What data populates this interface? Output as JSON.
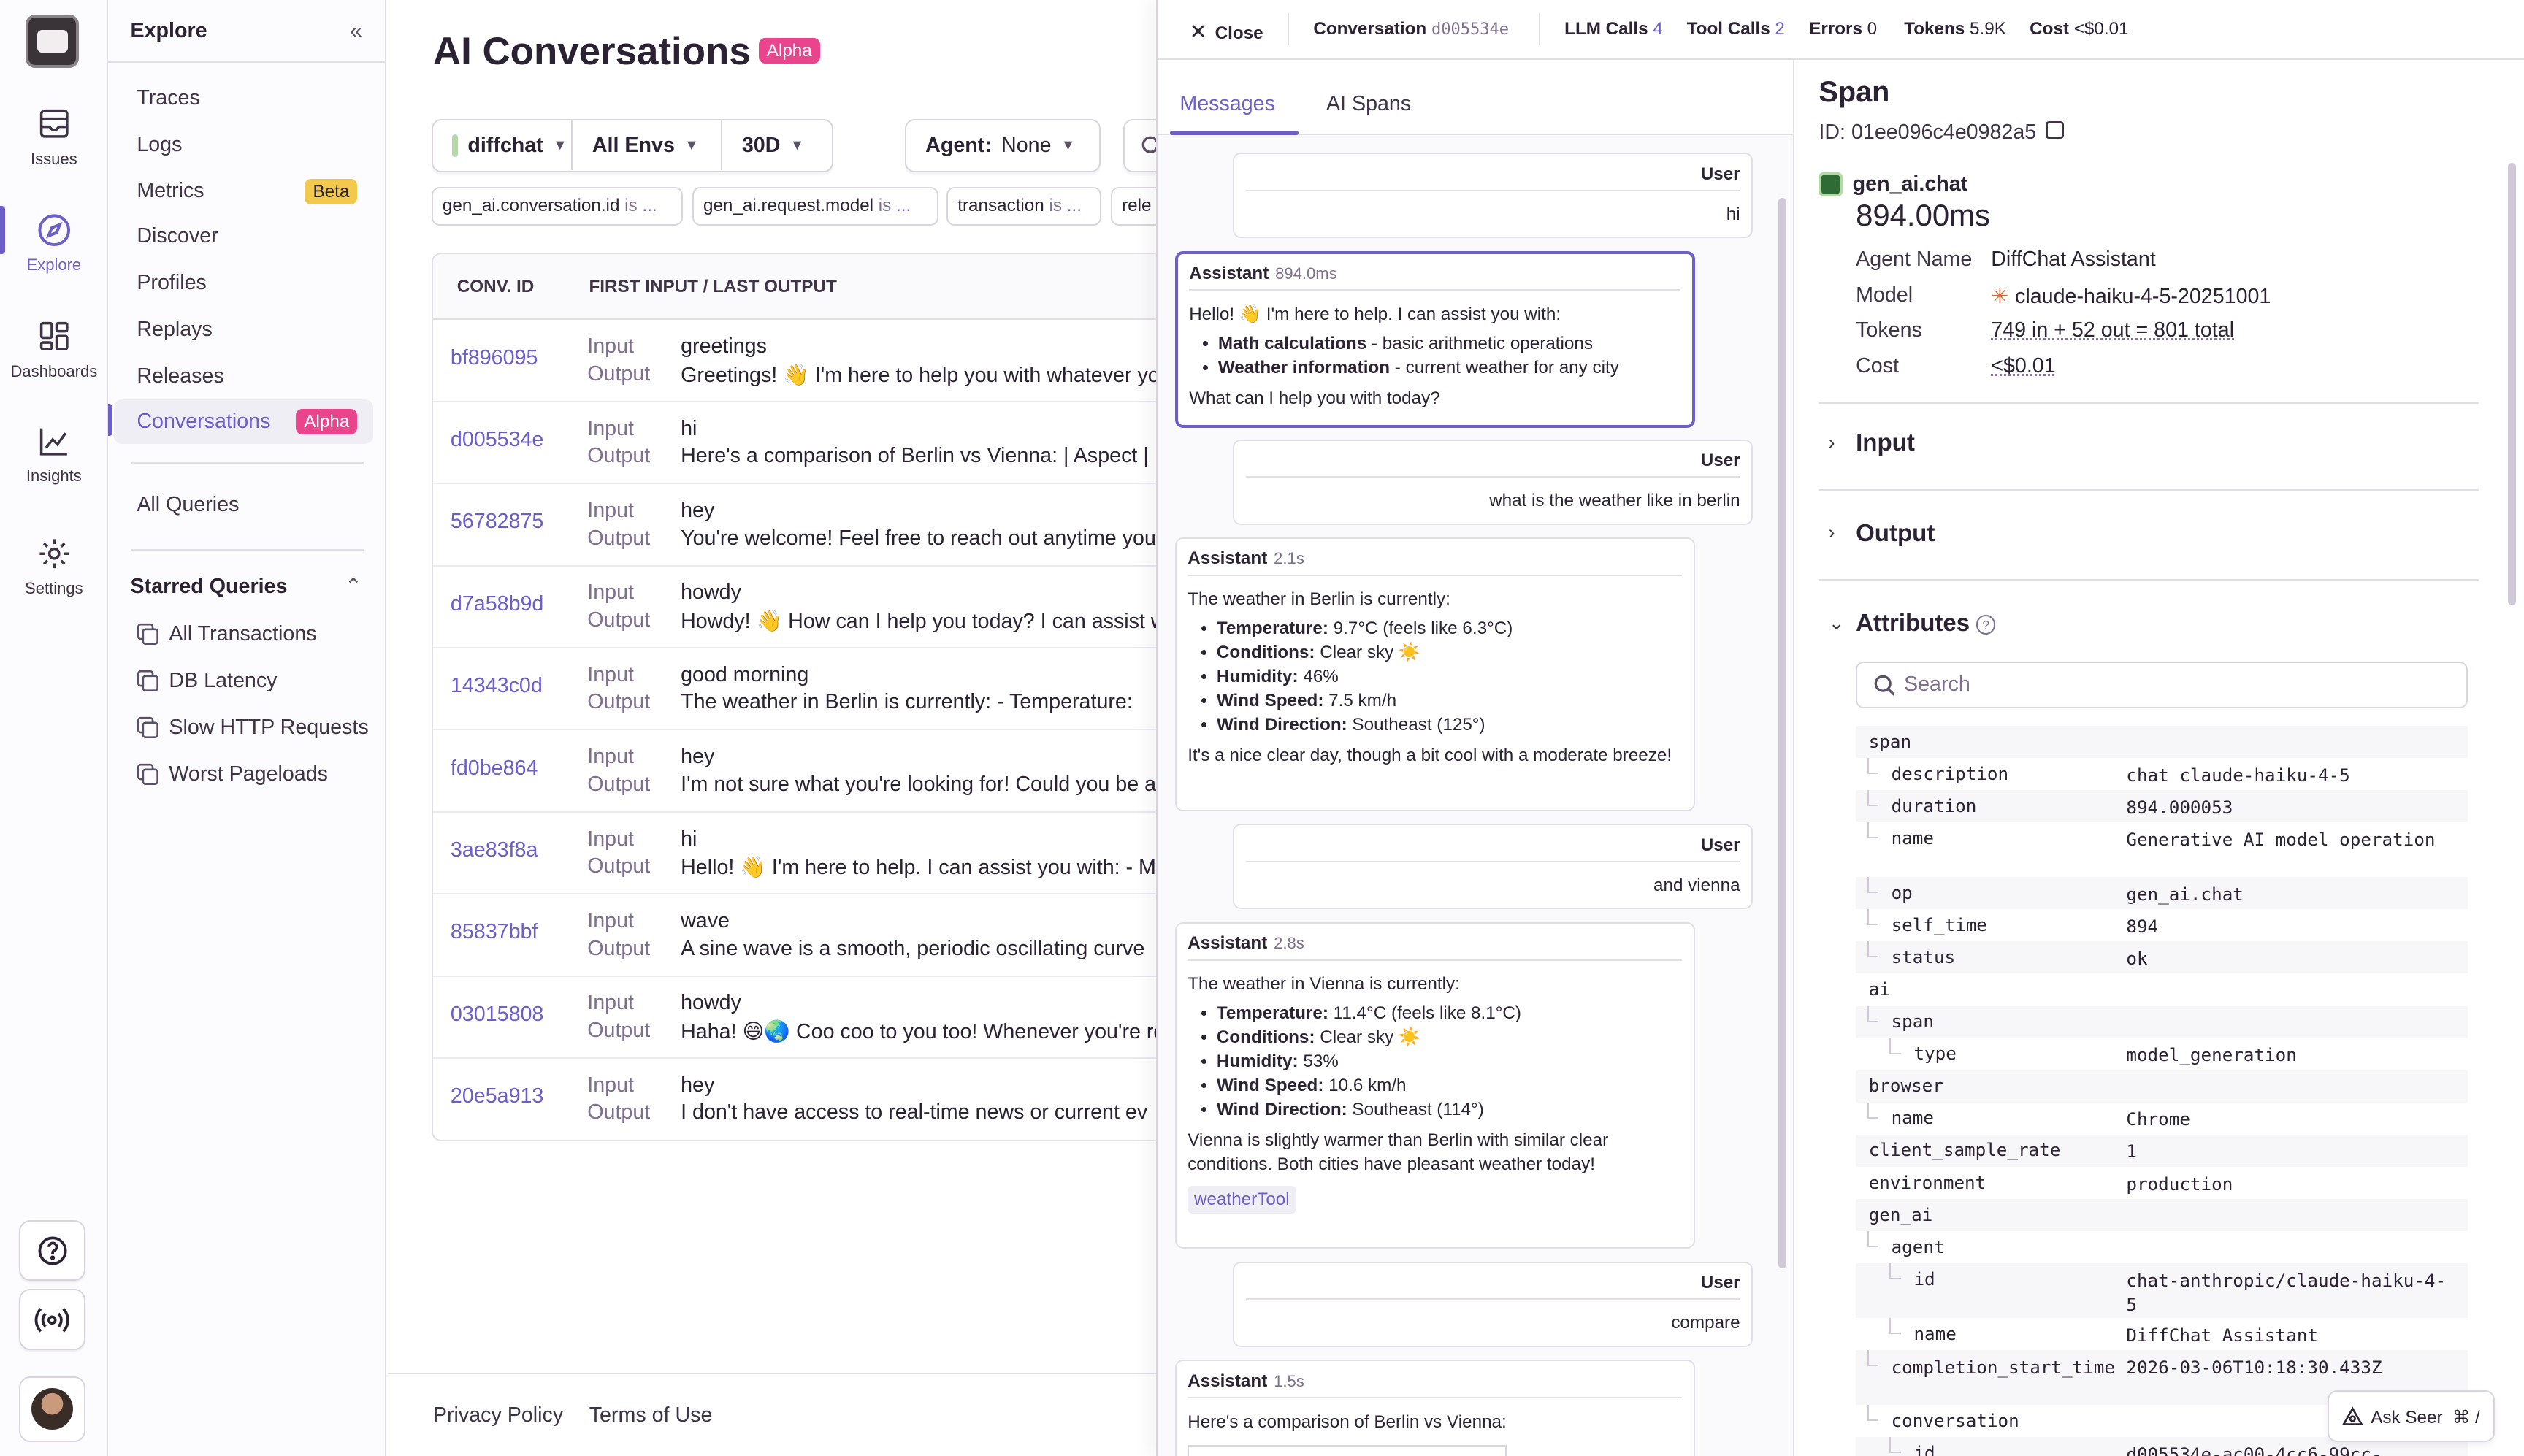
{
  "rail": {
    "items": [
      {
        "label": "Issues",
        "icon": "issues-icon"
      },
      {
        "label": "Explore",
        "icon": "compass-icon"
      },
      {
        "label": "Dashboards",
        "icon": "dashboards-icon"
      },
      {
        "label": "Insights",
        "icon": "insights-icon"
      },
      {
        "label": "Settings",
        "icon": "gear-icon"
      }
    ],
    "active": "Explore"
  },
  "nav": {
    "title": "Explore",
    "items": [
      "Traces",
      "Logs",
      "Metrics",
      "Discover",
      "Profiles",
      "Replays",
      "Releases",
      "Conversations"
    ],
    "metrics_badge": "Beta",
    "conversations_badge": "Alpha",
    "all_queries": "All Queries",
    "starred_title": "Starred Queries",
    "starred": [
      "All Transactions",
      "DB Latency",
      "Slow HTTP Requests",
      "Worst Pageloads"
    ]
  },
  "main": {
    "title": "AI Conversations",
    "title_badge": "Alpha",
    "project": "diffchat",
    "env": "All Envs",
    "range": "30D",
    "agent_label": "Agent:",
    "agent_value": "None",
    "pills": [
      {
        "key": "gen_ai.conversation.id",
        "op": "is",
        "val": "..."
      },
      {
        "key": "gen_ai.request.model",
        "op": "is",
        "val": "..."
      },
      {
        "key": "transaction",
        "op": "is",
        "val": "..."
      },
      {
        "key": "rele",
        "op": "",
        "val": ""
      }
    ],
    "columns": [
      "CONV. ID",
      "FIRST INPUT / LAST OUTPUT"
    ],
    "input_label": "Input",
    "output_label": "Output",
    "rows": [
      {
        "id": "bf896095",
        "input": "greetings",
        "output": "Greetings! 👋 I'm here to help you with whatever yo"
      },
      {
        "id": "d005534e",
        "input": "hi",
        "output": "Here's a comparison of Berlin vs Vienna: | Aspect |"
      },
      {
        "id": "56782875",
        "input": "hey",
        "output": "You're welcome! Feel free to reach out anytime you"
      },
      {
        "id": "d7a58b9d",
        "input": "howdy",
        "output": "Howdy! 👋 How can I help you today? I can assist w"
      },
      {
        "id": "14343c0d",
        "input": "good morning",
        "output": "The weather in Berlin is currently: - Temperature:"
      },
      {
        "id": "fd0be864",
        "input": "hey",
        "output": "I'm not sure what you're looking for! Could you be a"
      },
      {
        "id": "3ae83f8a",
        "input": "hi",
        "output": "Hello! 👋 I'm here to help. I can assist you with: - Ma"
      },
      {
        "id": "85837bbf",
        "input": "wave",
        "output": "A sine wave is a smooth, periodic oscillating curve"
      },
      {
        "id": "03015808",
        "input": "howdy",
        "output": "Haha! 😄🌏 Coo coo to you too! Whenever you're rea"
      },
      {
        "id": "20e5a913",
        "input": "hey",
        "output": "I don't have access to real-time news or current ev"
      }
    ],
    "footer": [
      "Privacy Policy",
      "Terms of Use"
    ]
  },
  "drawer": {
    "close": "Close",
    "conversation_label": "Conversation",
    "conversation_id": "d005534e",
    "llm_calls_label": "LLM Calls",
    "llm_calls": "4",
    "tool_calls_label": "Tool Calls",
    "tool_calls": "2",
    "errors_label": "Errors",
    "errors": "0",
    "tokens_label": "Tokens",
    "tokens": "5.9K",
    "cost_label": "Cost",
    "cost": "<$0.01",
    "tabs": [
      "Messages",
      "AI Spans"
    ],
    "messages": {
      "user_label": "User",
      "assistant_label": "Assistant",
      "m1_user": "hi",
      "m2_time": "894.0ms",
      "m2_intro": "Hello! 👋 I'm here to help. I can assist you with:",
      "m2_b1k": "Math calculations",
      "m2_b1v": " - basic arithmetic operations",
      "m2_b2k": "Weather information",
      "m2_b2v": " - current weather for any city",
      "m2_outro": "What can I help you with today?",
      "m3_user": "what is the weather like in berlin",
      "m4_time": "2.1s",
      "m4_intro": "The weather in Berlin is currently:",
      "m4_b1k": "Temperature:",
      "m4_b1v": " 9.7°C (feels like 6.3°C)",
      "m4_b2k": "Conditions:",
      "m4_b2v": " Clear sky ☀️",
      "m4_b3k": "Humidity:",
      "m4_b3v": " 46%",
      "m4_b4k": "Wind Speed:",
      "m4_b4v": " 7.5 km/h",
      "m4_b5k": "Wind Direction:",
      "m4_b5v": " Southeast (125°)",
      "m4_outro": "It's a nice clear day, though a bit cool with a moderate breeze!",
      "m5_user": "and vienna",
      "m6_time": "2.8s",
      "m6_intro": "The weather in Vienna is currently:",
      "m6_b1k": "Temperature:",
      "m6_b1v": " 11.4°C (feels like 8.1°C)",
      "m6_b2k": "Conditions:",
      "m6_b2v": " Clear sky ☀️",
      "m6_b3k": "Humidity:",
      "m6_b3v": " 53%",
      "m6_b4k": "Wind Speed:",
      "m6_b4v": " 10.6 km/h",
      "m6_b5k": "Wind Direction:",
      "m6_b5v": " Southeast (114°)",
      "m6_outro": "Vienna is slightly warmer than Berlin with similar clear conditions. Both cities have pleasant weather today!",
      "m6_tool": "weatherTool",
      "m7_user": "compare",
      "m8_time": "1.5s",
      "m8_intro": "Here's a comparison of Berlin vs Vienna:"
    },
    "span": {
      "title": "Span",
      "id_label": "ID:",
      "id": "01ee096c4e0982a5",
      "op": "gen_ai.chat",
      "duration": "894.00ms",
      "agent_name_label": "Agent Name",
      "agent_name": "DiffChat Assistant",
      "model_label": "Model",
      "model": "claude-haiku-4-5-20251001",
      "tokens_label": "Tokens",
      "tokens": "749 in + 52 out = 801 total",
      "cost_label": "Cost",
      "cost": "<$0.01",
      "sections": [
        "Input",
        "Output",
        "Attributes"
      ],
      "search_placeholder": "Search",
      "attributes": [
        {
          "k": "span",
          "v": ""
        },
        {
          "k": "description",
          "v": "chat claude-haiku-4-5"
        },
        {
          "k": "duration",
          "v": "894.000053"
        },
        {
          "k": "name",
          "v": "Generative AI model operation"
        },
        {
          "k": "op",
          "v": "gen_ai.chat"
        },
        {
          "k": "self_time",
          "v": "894"
        },
        {
          "k": "status",
          "v": "ok"
        },
        {
          "k": "ai",
          "v": ""
        },
        {
          "k": "span",
          "v": ""
        },
        {
          "k": "type",
          "v": "model_generation"
        },
        {
          "k": "browser",
          "v": ""
        },
        {
          "k": "name",
          "v": "Chrome"
        },
        {
          "k": "client_sample_rate",
          "v": "1"
        },
        {
          "k": "environment",
          "v": "production"
        },
        {
          "k": "gen_ai",
          "v": ""
        },
        {
          "k": "agent",
          "v": ""
        },
        {
          "k": "id",
          "v": "chat-anthropic/claude-haiku-4-5"
        },
        {
          "k": "name",
          "v": "DiffChat Assistant"
        },
        {
          "k": "completion_start_time",
          "v": "2026-03-06T10:18:30.433Z"
        },
        {
          "k": "conversation",
          "v": ""
        },
        {
          "k": "id",
          "v": "d005534e-ac00-4cc6-99cc-"
        }
      ],
      "ask_seer": "Ask Seer",
      "ask_seer_shortcut": "⌘ /"
    }
  },
  "colors": {
    "accent": "#6c5fc7",
    "alpha": "#e9458c",
    "beta": "#f2c94c"
  }
}
